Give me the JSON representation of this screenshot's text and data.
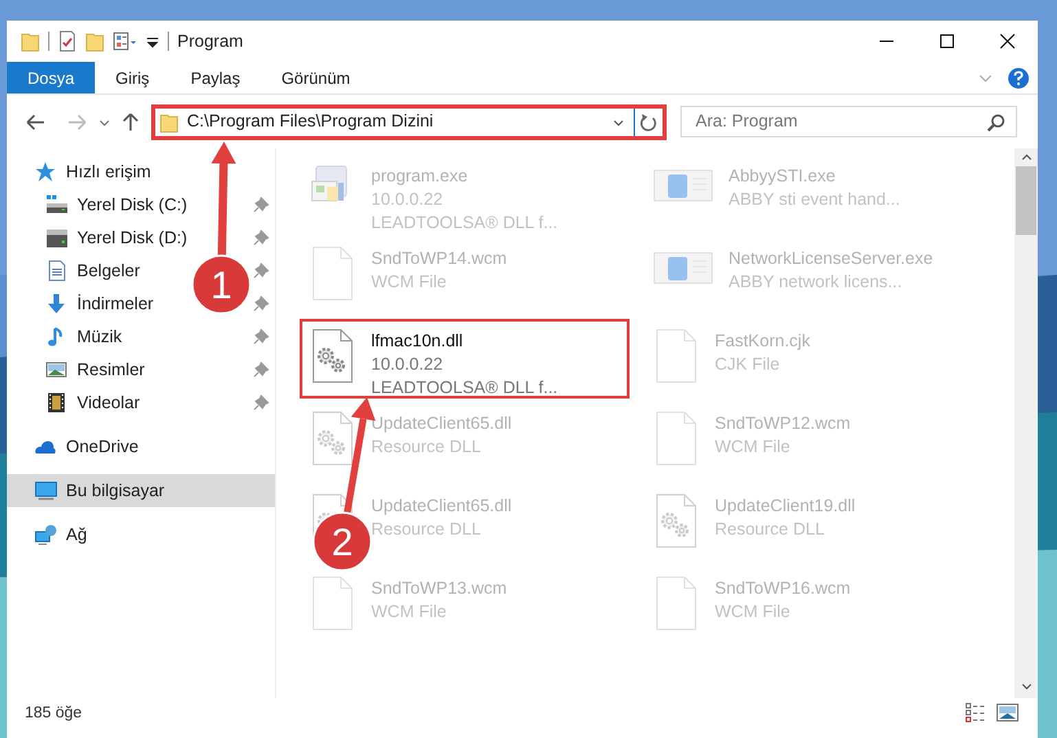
{
  "window": {
    "title": "Program"
  },
  "ribbon_tabs": [
    {
      "label": "Dosya",
      "selected": true
    },
    {
      "label": "Giriş",
      "selected": false
    },
    {
      "label": "Paylaş",
      "selected": false
    },
    {
      "label": "Görünüm",
      "selected": false
    }
  ],
  "address": {
    "path": "C:\\Program Files\\Program Dizini",
    "highlighted": true
  },
  "search": {
    "placeholder": "Ara: Program"
  },
  "nav": [
    {
      "label": "Hızlı erişim",
      "kind": "star",
      "selected": false,
      "children": [
        {
          "label": "Yerel Disk (C:)",
          "kind": "disk-c",
          "pinned": true,
          "selected": false
        },
        {
          "label": "Yerel Disk (D:)",
          "kind": "disk",
          "pinned": true,
          "selected": false
        },
        {
          "label": "Belgeler",
          "kind": "docs",
          "pinned": true,
          "selected": false
        },
        {
          "label": "İndirmeler",
          "kind": "download",
          "pinned": true,
          "selected": false
        },
        {
          "label": "Müzik",
          "kind": "music",
          "pinned": true,
          "selected": false
        },
        {
          "label": "Resimler",
          "kind": "pictures",
          "pinned": true,
          "selected": false
        },
        {
          "label": "Videolar",
          "kind": "videos",
          "pinned": true,
          "selected": false
        }
      ]
    },
    {
      "label": "OneDrive",
      "kind": "cloud",
      "selected": false
    },
    {
      "label": "Bu bilgisayar",
      "kind": "pc",
      "selected": true
    },
    {
      "label": "Ağ",
      "kind": "network",
      "selected": false
    }
  ],
  "files": [
    {
      "name": "program.exe",
      "details": [
        "10.0.0.22",
        "LEADTOOLSA® DLL f..."
      ],
      "kind": "installer",
      "focused": false
    },
    {
      "name": "AbbyySTI.exe",
      "details": [
        "ABBY sti event hand..."
      ],
      "kind": "app",
      "focused": false
    },
    {
      "name": "SndToWP14.wcm",
      "details": [
        "WCM File"
      ],
      "kind": "blank",
      "focused": false
    },
    {
      "name": "NetworkLicenseServer.exe",
      "details": [
        "ABBY network licens..."
      ],
      "kind": "app",
      "focused": false
    },
    {
      "name": "lfmac10n.dll",
      "details": [
        "10.0.0.22",
        "LEADTOOLSA® DLL f..."
      ],
      "kind": "gear",
      "focused": true
    },
    {
      "name": "FastKorn.cjk",
      "details": [
        "CJK File"
      ],
      "kind": "blank",
      "focused": false
    },
    {
      "name": "UpdateClient65.dll",
      "details": [
        "Resource DLL"
      ],
      "kind": "gear",
      "focused": false
    },
    {
      "name": "SndToWP12.wcm",
      "details": [
        "WCM File"
      ],
      "kind": "blank",
      "focused": false
    },
    {
      "name": "UpdateClient65.dll",
      "details": [
        "Resource DLL"
      ],
      "kind": "gear",
      "focused": false
    },
    {
      "name": "UpdateClient19.dll",
      "details": [
        "Resource DLL"
      ],
      "kind": "gear",
      "focused": false
    },
    {
      "name": "SndToWP13.wcm",
      "details": [
        "WCM File"
      ],
      "kind": "blank",
      "focused": false
    },
    {
      "name": "SndToWP16.wcm",
      "details": [
        "WCM File"
      ],
      "kind": "blank",
      "focused": false
    }
  ],
  "status_bar": {
    "item_count": "185 öğe"
  },
  "callouts": [
    {
      "number": "1"
    },
    {
      "number": "2"
    }
  ]
}
